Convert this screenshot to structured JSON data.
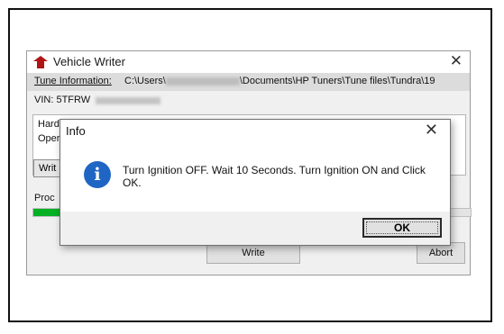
{
  "vehicle_writer": {
    "title": "Vehicle Writer",
    "tune_label": "Tune Information:",
    "tune_path_start": "C:\\Users\\",
    "tune_path_end": "\\Documents\\HP Tuners\\Tune files\\Tundra\\19",
    "vin_label": "VIN: 5TFRW",
    "hardware_partial": "Hard",
    "operating_partial": "Oper",
    "write_partial": "Writ",
    "process_label": "Proc",
    "progress_fraction": 0.07,
    "write_button": "Write",
    "abort_button": "Abort",
    "progress_color": "#06b025"
  },
  "dialog": {
    "title": "Info",
    "message": "Turn Ignition OFF. Wait 10 Seconds. Turn Ignition ON and Click OK.",
    "ok_button": "OK",
    "icon": "info-icon",
    "icon_color": "#1f66c4"
  }
}
